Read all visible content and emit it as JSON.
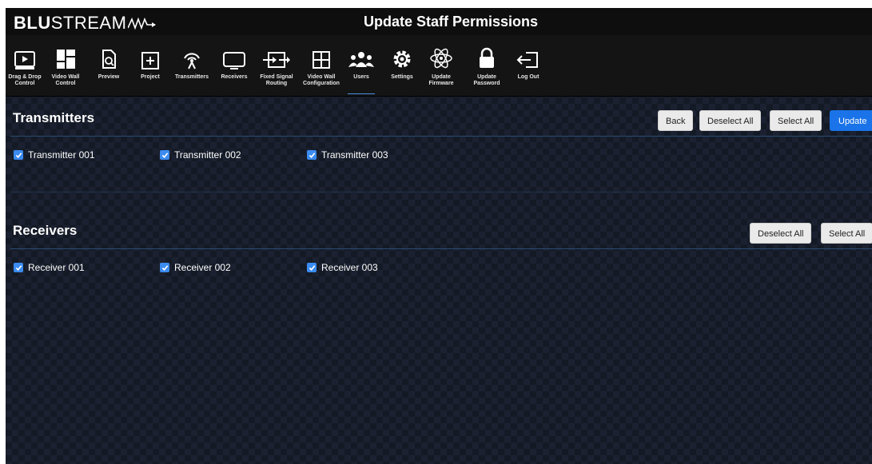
{
  "app": {
    "logo_bold": "BLU",
    "logo_rest": "STREAM",
    "title": "Update Staff Permissions"
  },
  "nav": [
    {
      "label": "Drag & Drop\nControl",
      "icon": "play-screen-icon"
    },
    {
      "label": "Video Wall\nControl",
      "icon": "video-wall-icon"
    },
    {
      "label": "Preview",
      "icon": "preview-doc-icon"
    },
    {
      "label": "Project",
      "icon": "project-plus-icon"
    },
    {
      "label": "Transmitters",
      "icon": "antenna-icon"
    },
    {
      "label": "Receivers",
      "icon": "monitor-icon"
    },
    {
      "label": "Fixed Signal\nRouting",
      "icon": "routing-icon"
    },
    {
      "label": "Video Wall\nConfiguration",
      "icon": "grid-icon"
    },
    {
      "label": "Users",
      "icon": "users-icon",
      "active": true
    },
    {
      "label": "Settings",
      "icon": "gear-icon"
    },
    {
      "label": "Update\nFirmware",
      "icon": "atom-icon"
    },
    {
      "label": "Update\nPassword",
      "icon": "lock-icon"
    },
    {
      "label": "Log Out",
      "icon": "logout-icon"
    }
  ],
  "transmitters": {
    "title": "Transmitters",
    "buttons": {
      "back": "Back",
      "deselect": "Deselect All",
      "select": "Select All",
      "update": "Update"
    },
    "items": [
      {
        "label": "Transmitter 001",
        "checked": true
      },
      {
        "label": "Transmitter 002",
        "checked": true
      },
      {
        "label": "Transmitter 003",
        "checked": true
      }
    ]
  },
  "receivers": {
    "title": "Receivers",
    "buttons": {
      "deselect": "Deselect All",
      "select": "Select All"
    },
    "items": [
      {
        "label": "Receiver 001",
        "checked": true
      },
      {
        "label": "Receiver 002",
        "checked": true
      },
      {
        "label": "Receiver 003",
        "checked": true
      }
    ]
  },
  "colors": {
    "accent": "#1a73e8",
    "checkbox": "#3b8bf0",
    "topbar": "#0e0e0e",
    "background": "#141a25"
  }
}
